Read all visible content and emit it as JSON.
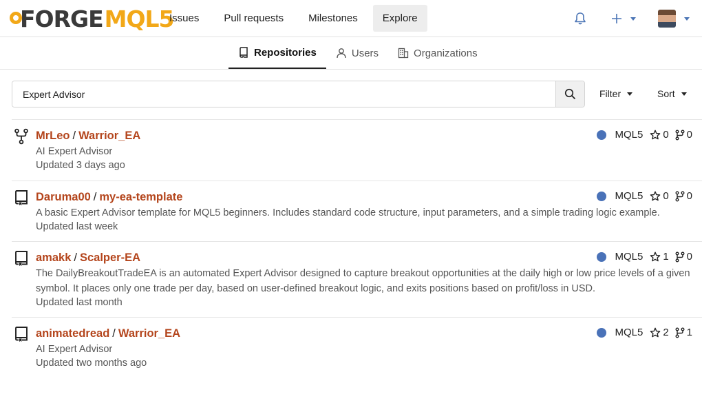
{
  "brand": {
    "forge": "FORGE",
    "mql": "MQL5"
  },
  "nav": {
    "links": [
      "Issues",
      "Pull requests",
      "Milestones",
      "Explore"
    ],
    "active": "Explore"
  },
  "tabs": [
    "Repositories",
    "Users",
    "Organizations"
  ],
  "search": {
    "value": "Expert Advisor"
  },
  "controls": {
    "filter": "Filter",
    "sort": "Sort"
  },
  "repos": [
    {
      "owner": "MrLeo",
      "name": "Warrior_EA",
      "desc": "AI Expert Advisor",
      "updated": "Updated 3 days ago",
      "lang": "MQL5",
      "stars": "0",
      "forks": "0",
      "icon": "fork-icon"
    },
    {
      "owner": "Daruma00",
      "name": "my-ea-template",
      "desc": "A basic Expert Advisor template for MQL5 beginners. Includes standard code structure, input parameters, and a simple trading logic example.",
      "updated": "Updated last week",
      "lang": "MQL5",
      "stars": "0",
      "forks": "0",
      "icon": "repo-icon"
    },
    {
      "owner": "amakk",
      "name": "Scalper-EA",
      "desc": "The DailyBreakoutTradeEA is an automated Expert Advisor designed to capture breakout opportunities at the daily high or low price levels of a given symbol. It places only one trade per day, based on user-defined breakout logic, and exits positions based on profit/loss in USD.",
      "updated": "Updated last month",
      "lang": "MQL5",
      "stars": "1",
      "forks": "0",
      "icon": "repo-icon"
    },
    {
      "owner": "animatedread",
      "name": "Warrior_EA",
      "desc": "AI Expert Advisor",
      "updated": "Updated two months ago",
      "lang": "MQL5",
      "stars": "2",
      "forks": "1",
      "icon": "repo-icon"
    }
  ],
  "colors": {
    "link": "#b4451c",
    "lang_dot": "#4a72b8",
    "accent": "#f2a818"
  }
}
